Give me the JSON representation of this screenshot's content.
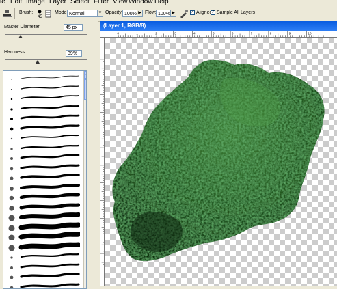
{
  "menu": [
    "le",
    "Edit",
    "Image",
    "Layer",
    "Select",
    "Filter",
    "View",
    "Window",
    "Help"
  ],
  "options": {
    "brush_label": "Brush:",
    "mode_label": "Mode:",
    "mode_value": "Normal",
    "opacity_label": "Opacity:",
    "opacity_value": "100%",
    "flow_label": "Flow:",
    "flow_value": "100%",
    "aligned_label": "Aligned",
    "sample_all_layers_label": "Sample All Layers"
  },
  "brush_panel": {
    "master_diameter_label": "Master Diameter",
    "master_diameter_value": "45 px",
    "hardness_label": "Hardness:",
    "hardness_value": "39%",
    "master_diameter_slider_fraction": 0.18,
    "hardness_slider_fraction": 0.39,
    "brushes": [
      {
        "size": "1"
      },
      {
        "size": "3"
      },
      {
        "size": "5"
      },
      {
        "size": "9"
      },
      {
        "size": "13"
      },
      {
        "size": "19"
      },
      {
        "size": "5"
      },
      {
        "size": "9"
      },
      {
        "size": "13"
      },
      {
        "size": "17"
      },
      {
        "size": "21"
      },
      {
        "size": "27"
      },
      {
        "size": "35"
      },
      {
        "size": "45"
      },
      {
        "size": "65"
      },
      {
        "size": "100"
      },
      {
        "size": "200"
      },
      {
        "size": "300"
      },
      {
        "size": "9"
      },
      {
        "size": "13"
      },
      {
        "size": "19"
      },
      {
        "size": "17"
      },
      {
        "size": "45"
      },
      {
        "size": "65"
      },
      {
        "size": "100"
      },
      {
        "size": "200"
      }
    ]
  },
  "document": {
    "title": "(Layer 1, RGB/8)",
    "ruler_labels": [
      "0",
      "1",
      "2",
      "3",
      "4",
      "5",
      "6",
      "7",
      "8",
      "9",
      "10"
    ]
  },
  "colors": {
    "title_bar": "#0a5de0",
    "foliage_dark": "#1a4a1e",
    "foliage_light": "#3f8a3a"
  }
}
